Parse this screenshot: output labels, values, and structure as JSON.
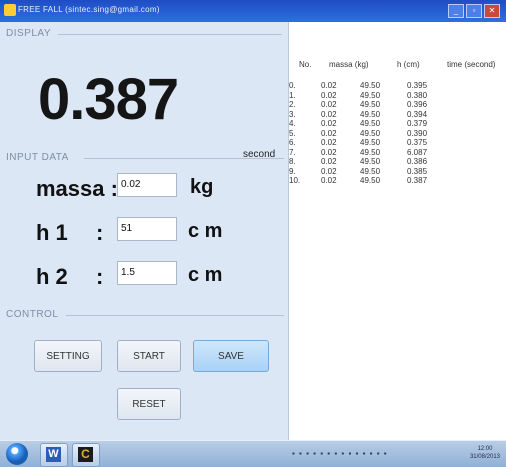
{
  "window": {
    "title": "FREE FALL  (sintec.sing@gmail.com)",
    "buttons": [
      "_",
      "▫",
      "✕"
    ]
  },
  "display": {
    "group_label": "DISPLAY",
    "value": "0.387",
    "unit": "second"
  },
  "input": {
    "group_label": "INPUT DATA",
    "fields": [
      {
        "label": "massa :",
        "value": "0.02",
        "unit": "kg"
      },
      {
        "label": "h 1",
        "colon": ":",
        "value": "51",
        "unit": "c m"
      },
      {
        "label": "h 2",
        "colon": ":",
        "value": "1.5",
        "unit": "c m"
      }
    ]
  },
  "control": {
    "group_label": "CONTROL",
    "setting": "SETTING",
    "start": "START",
    "save": "SAVE",
    "reset": "RESET"
  },
  "table": {
    "headers": [
      "No.",
      "massa (kg)",
      "h (cm)",
      "time (second)"
    ],
    "rows": [
      [
        "0.",
        "0.02",
        "49.50",
        "0.395"
      ],
      [
        "1.",
        "0.02",
        "49.50",
        "0.380"
      ],
      [
        "2.",
        "0.02",
        "49.50",
        "0.396"
      ],
      [
        "3.",
        "0.02",
        "49.50",
        "0.394"
      ],
      [
        "4.",
        "0.02",
        "49.50",
        "0.379"
      ],
      [
        "5.",
        "0.02",
        "49.50",
        "0.390"
      ],
      [
        "6.",
        "0.02",
        "49.50",
        "0.375"
      ],
      [
        "7.",
        "0.02",
        "49.50",
        "6.087"
      ],
      [
        "8.",
        "0.02",
        "49.50",
        "0.386"
      ],
      [
        "9.",
        "0.02",
        "49.50",
        "0.385"
      ],
      [
        "10.",
        "0.02",
        "49.50",
        "0.387"
      ]
    ]
  },
  "taskbar": {
    "word_icon": "W",
    "app_icon": "C",
    "clock_time": "12:00",
    "clock_date": "31/08/2013"
  }
}
